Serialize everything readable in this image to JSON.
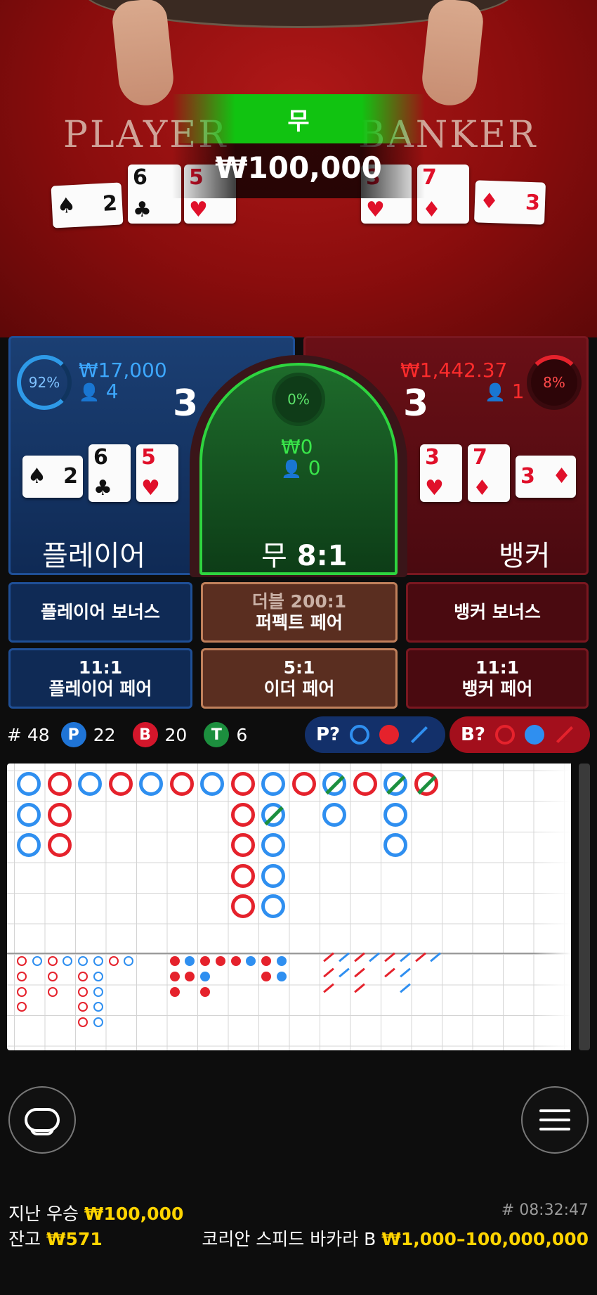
{
  "video": {
    "player_word": "PLAYER",
    "banker_word": "BANKER",
    "result_label": "무",
    "result_amount": "₩100,000",
    "player_cards": [
      {
        "rank": "2",
        "suit": "♠",
        "color": "black"
      },
      {
        "rank": "6",
        "suit": "♣",
        "color": "black"
      },
      {
        "rank": "5",
        "suit": "♥",
        "color": "red"
      }
    ],
    "banker_cards": [
      {
        "rank": "3",
        "suit": "♥",
        "color": "red"
      },
      {
        "rank": "7",
        "suit": "♦",
        "color": "red"
      },
      {
        "rank": "3",
        "suit": "♦",
        "color": "red"
      }
    ]
  },
  "player": {
    "percent": "92%",
    "amount": "₩17,000",
    "count": "4",
    "score": "3",
    "label": "플레이어",
    "cards": [
      {
        "rank": "2",
        "suit": "♠",
        "color": "black"
      },
      {
        "rank": "6",
        "suit": "♣",
        "color": "black"
      },
      {
        "rank": "5",
        "suit": "♥",
        "color": "red"
      }
    ]
  },
  "banker": {
    "percent": "8%",
    "amount": "₩1,442.37",
    "count": "1",
    "score": "3",
    "label": "뱅커",
    "cards": [
      {
        "rank": "3",
        "suit": "♥",
        "color": "red"
      },
      {
        "rank": "7",
        "suit": "♦",
        "color": "red"
      },
      {
        "rank": "3",
        "suit": "♦",
        "color": "red"
      }
    ]
  },
  "tie": {
    "percent": "0%",
    "amount": "₩0",
    "count": "0",
    "label": "무",
    "odds": "8:1"
  },
  "side_bets": {
    "player_bonus": "플레이어 보너스",
    "perfect_pair_odds": "더블 200:1",
    "perfect_pair": "퍼펙트 페어",
    "banker_bonus": "뱅커 보너스",
    "player_pair_odds": "11:1",
    "player_pair": "플레이어 페어",
    "either_pair_odds": "5:1",
    "either_pair": "이더 페어",
    "banker_pair_odds": "11:1",
    "banker_pair": "뱅커 페어"
  },
  "stats": {
    "round_label": "# 48",
    "p_letter": "P",
    "p_count": "22",
    "b_letter": "B",
    "b_count": "20",
    "t_letter": "T",
    "t_count": "6",
    "player_predict": "P?",
    "banker_predict": "B?"
  },
  "footer": {
    "last_win_label": "지난 우승",
    "last_win_amount": "₩100,000",
    "balance_label": "잔고",
    "balance_amount": "₩571",
    "round_time": "# 08:32:47",
    "table_name": "코리안 스피드 바카라 B",
    "limits": "₩1,000–100,000,000"
  },
  "colors": {
    "player_blue": "#2f8ff0",
    "banker_red": "#e5222c",
    "tie_green": "#2ed53f",
    "gold": "#ffd400"
  },
  "icons": [
    "person-icon",
    "chat-icon",
    "menu-icon"
  ]
}
